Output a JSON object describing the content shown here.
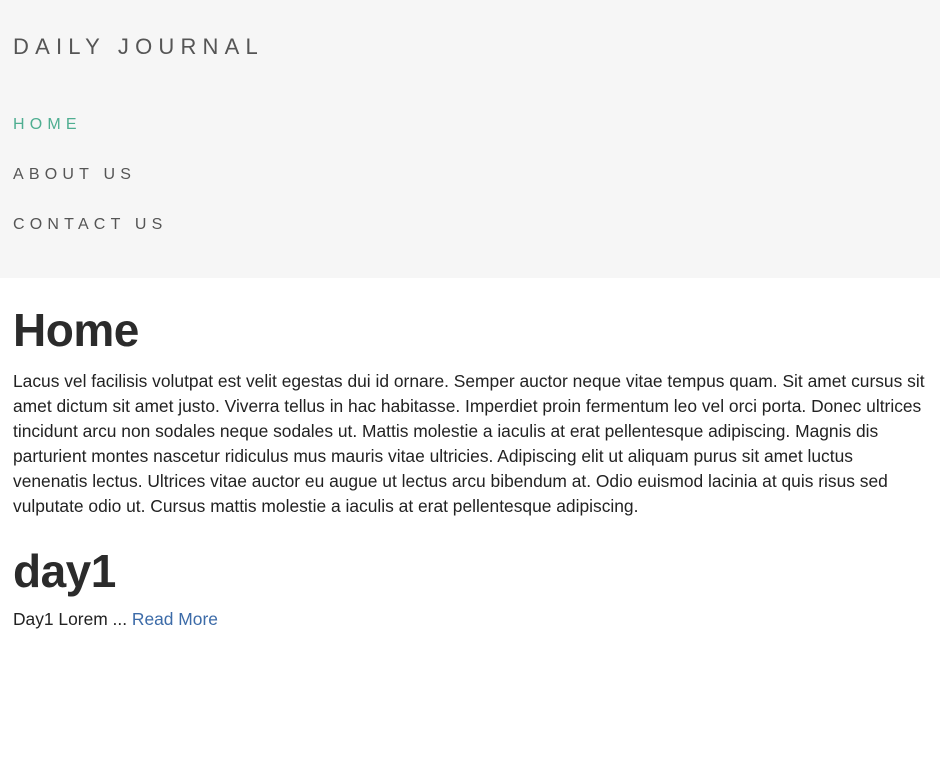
{
  "header": {
    "brand": "DAILY JOURNAL",
    "nav": [
      {
        "label": "HOME",
        "active": true
      },
      {
        "label": "ABOUT US",
        "active": false
      },
      {
        "label": "CONTACT US",
        "active": false
      }
    ]
  },
  "main": {
    "title": "Home",
    "intro": "Lacus vel facilisis volutpat est velit egestas dui id ornare. Semper auctor neque vitae tempus quam. Sit amet cursus sit amet dictum sit amet justo. Viverra tellus in hac habitasse. Imperdiet proin fermentum leo vel orci porta. Donec ultrices tincidunt arcu non sodales neque sodales ut. Mattis molestie a iaculis at erat pellentesque adipiscing. Magnis dis parturient montes nascetur ridiculus mus mauris vitae ultricies. Adipiscing elit ut aliquam purus sit amet luctus venenatis lectus. Ultrices vitae auctor eu augue ut lectus arcu bibendum at. Odio euismod lacinia at quis risus sed vulputate odio ut. Cursus mattis molestie a iaculis at erat pellentesque adipiscing.",
    "posts": [
      {
        "title": "day1",
        "excerpt": "Day1 Lorem ... ",
        "read_more": "Read More"
      }
    ]
  },
  "colors": {
    "header_background": "#f6f6f6",
    "nav_active": "#4fae91",
    "nav_default": "#555555",
    "link": "#3c6ba8"
  }
}
